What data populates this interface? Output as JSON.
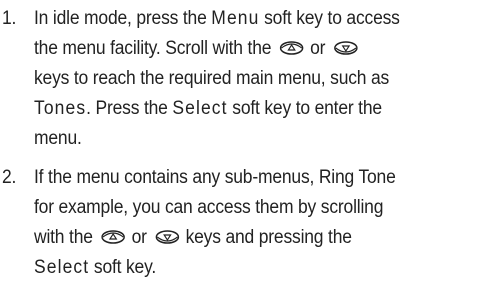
{
  "steps": [
    {
      "number": "1.",
      "lines": [
        [
          "In idle mode, press the ",
          "Menu",
          " soft key to access"
        ],
        [
          "the menu facility. Scroll with the",
          "or",
          "keys to reach the required main menu, such as"
        ],
        [
          "keys to reach the required main menu, such as"
        ],
        [
          "Tones",
          ". Press the ",
          "Select",
          " soft key to enter the"
        ],
        [
          "menu."
        ]
      ]
    },
    {
      "number": "2.",
      "lines": [
        [
          "If the menu contains any sub-menus, Ring Tone"
        ],
        [
          "for example, you can access them by scrolling"
        ],
        [
          "with the",
          "or",
          "keys and pressing the"
        ],
        [
          "Select",
          " soft key."
        ]
      ]
    }
  ],
  "icons": {
    "up": "up-scroll-key-icon",
    "down": "down-scroll-key-icon"
  }
}
